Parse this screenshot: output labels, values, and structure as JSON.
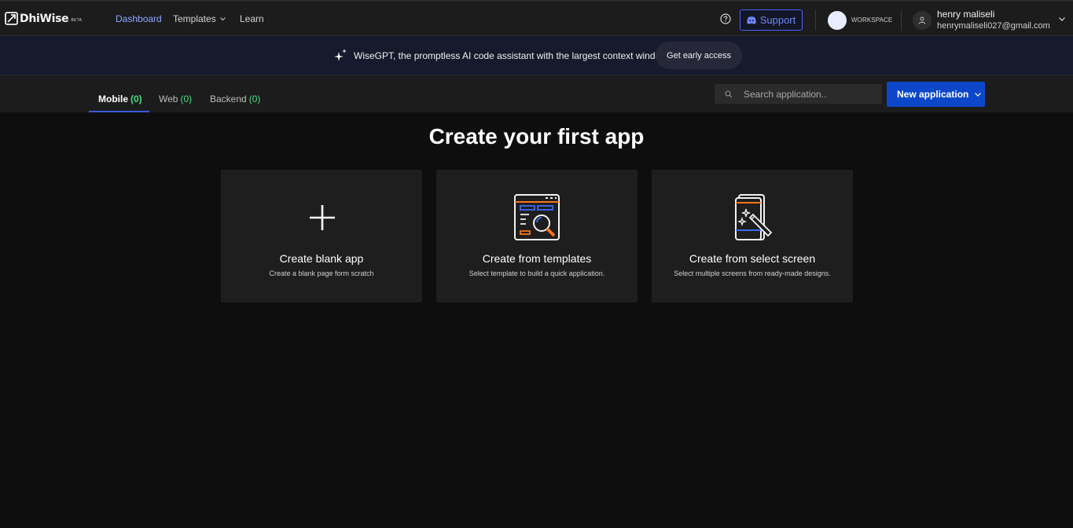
{
  "nav": {
    "logo_text": "DhiWise",
    "logo_badge": "BETA",
    "links": [
      {
        "label": "Dashboard"
      },
      {
        "label": "Templates"
      },
      {
        "label": "Learn"
      }
    ],
    "support_label": "Support",
    "workspace_label": "WORKSPACE",
    "user_name": "henry maliseli",
    "user_email": "henrymaliseli027@gmail.com"
  },
  "banner": {
    "text": "WiseGPT, the promptless AI code assistant with the largest context window.",
    "button_label": "Get early access"
  },
  "tabs": [
    {
      "label": "Mobile",
      "count": "(0)"
    },
    {
      "label": "Web",
      "count": "(0)"
    },
    {
      "label": "Backend",
      "count": "(0)"
    }
  ],
  "search": {
    "placeholder": "Search application.."
  },
  "new_app_label": "New application",
  "main": {
    "title": "Create your first app",
    "cards": [
      {
        "title": "Create blank app",
        "subtitle": "Create a blank page form scratch",
        "icon": "plus-icon"
      },
      {
        "title": "Create from templates",
        "subtitle": "Select template to build a quick application.",
        "icon": "template-search-icon"
      },
      {
        "title": "Create from select screen",
        "subtitle": "Select multiple screens from ready-made designs.",
        "icon": "screen-magic-icon"
      }
    ]
  },
  "colors": {
    "accent_blue": "#0d47c9",
    "link_active": "#8fa9ff",
    "count_green": "#4ade80",
    "support_blue": "#4a62ff",
    "illustration_orange": "#f97316",
    "illustration_blue": "#3b6cf6"
  }
}
